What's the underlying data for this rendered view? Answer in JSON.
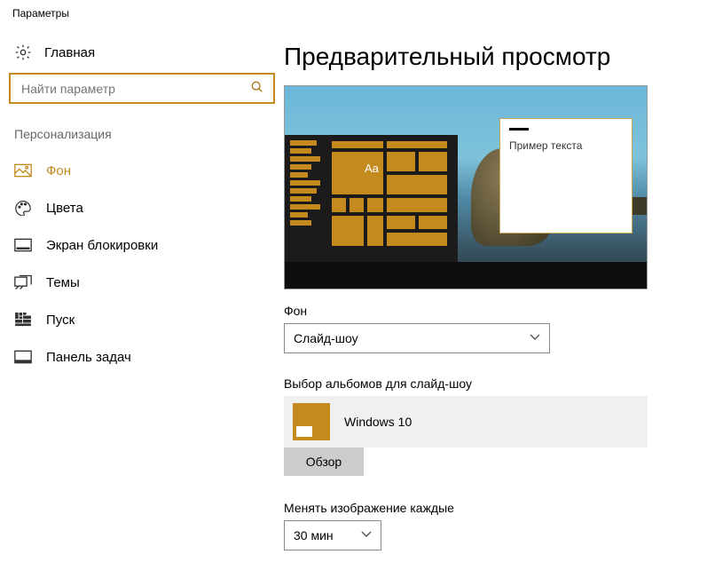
{
  "window_title": "Параметры",
  "sidebar": {
    "home_label": "Главная",
    "search_placeholder": "Найти параметр",
    "section_title": "Персонализация",
    "items": [
      {
        "label": "Фон",
        "icon": "picture"
      },
      {
        "label": "Цвета",
        "icon": "palette"
      },
      {
        "label": "Экран блокировки",
        "icon": "lock"
      },
      {
        "label": "Темы",
        "icon": "themes"
      },
      {
        "label": "Пуск",
        "icon": "start"
      },
      {
        "label": "Панель задач",
        "icon": "taskbar"
      }
    ]
  },
  "main": {
    "heading": "Предварительный просмотр",
    "preview_sample_text": "Пример текста",
    "preview_aa": "Aa",
    "background_label": "Фон",
    "background_value": "Слайд-шоу",
    "albums_label": "Выбор альбомов для слайд-шоу",
    "albums": [
      {
        "name": "Windows 10"
      }
    ],
    "browse_label": "Обзор",
    "interval_label": "Менять изображение каждые",
    "interval_value": "30 мин"
  },
  "accent_color": "#c58a1e"
}
